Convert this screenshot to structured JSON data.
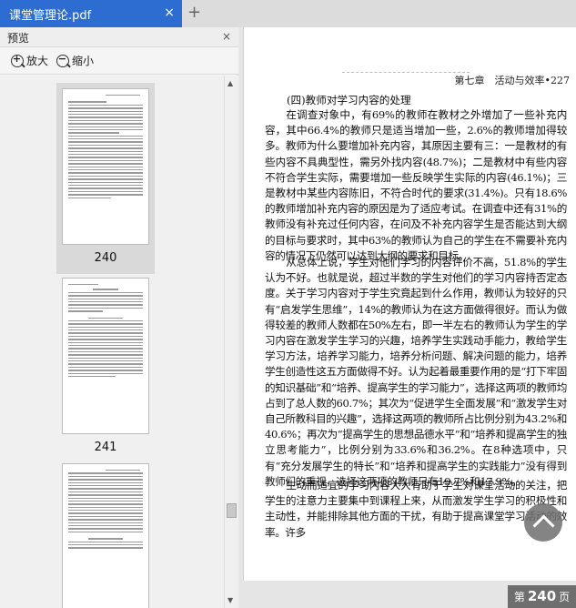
{
  "tab": {
    "title": "课堂管理论.pdf",
    "close": "×",
    "add": "+"
  },
  "sidebar": {
    "title": "预览",
    "close": "×",
    "zoom_in": "放大",
    "zoom_out": "缩小",
    "thumbnails": [
      {
        "label": "240",
        "selected": true
      },
      {
        "label": "241",
        "selected": false
      },
      {
        "label": "",
        "selected": false
      }
    ]
  },
  "document": {
    "running_head": "第七章　活动与效率•227",
    "section_title": "(四)教师对学习内容的处理",
    "paragraphs": [
      "在调查对象中，有69%的教师在教材之外增加了一些补充内容，其中66.4%的教师只是适当增加一些，2.6%的教师增加得较多。教师为什么要增加补充内容，其原因主要有三：一是教材的有些内容不具典型性，需另外找内容(48.7%)；二是教材中有些内容不符合学生实际，需要增加一些反映学生实际的内容(46.1%)；三是教材中某些内容陈旧，不符合时代的要求(31.4%)。只有18.6%的教师增加补充内容的原因是为了适应考试。在调查中还有31%的教师没有补充过任何内容，在问及不补充内容学生是否能达到大纲的目标与要求时，其中63%的教师认为自己的学生在不需要补充内容的情况下仍然可以达到大纲的要求和目标。",
      "从总体上说，学生对他们学习的内容评价不高，51.8%的学生认为不好。也就是说，超过半数的学生对他们的学习内容持否定态度。关于学习内容对于学生究竟起到什么作用，教师认为较好的只有“启发学生思维”，14%的教师认为在这方面做得很好。而认为做得较差的教师人数都在50%左右，即一半左右的教师认为学生的学习内容在激发学生学习的兴趣，培养学生实践动手能力，教给学生学习方法，培养学习能力，培养分析问题、解决问题的能力，培养学生创造性这五方面做得不好。认为起着最重要作用的是“打下牢固的知识基础”和“培养、提高学生的学习能力”，选择这两项的教师均占到了总人数的60.7%；其次为“促进学生全面发展”和“激发学生对自己所教科目的兴趣”，选择这两项的教师所占比例分别为43.2%和40.6%；再次为“提高学生的思想品德水平”和“培养和提高学生的独立思考能力”，比例分别为33.6%和36.2%。在8种选项中，只有“充分发展学生的特长”和“培养和提高学生的实践能力”没有得到教师们的重视，选择这两项的教师只有19.7%和17.9%。",
      "生动而适宜的学习内容大大有助于学生对课堂活动的关注，把学生的注意力主要集中到课程上来，从而激发学生学习的积极性和主动性，并能排除其他方面的干扰，有助于提高课堂学习活动的效率。许多"
    ]
  },
  "status": {
    "prefix": "第",
    "page": "240",
    "suffix": "页"
  },
  "colors": {
    "tab_active": "#2d6dd2",
    "selected_thumb": "#d9d9d9"
  },
  "icons": [
    "zoom-in-icon",
    "zoom-out-icon",
    "close-icon",
    "scroll-up-icon"
  ]
}
